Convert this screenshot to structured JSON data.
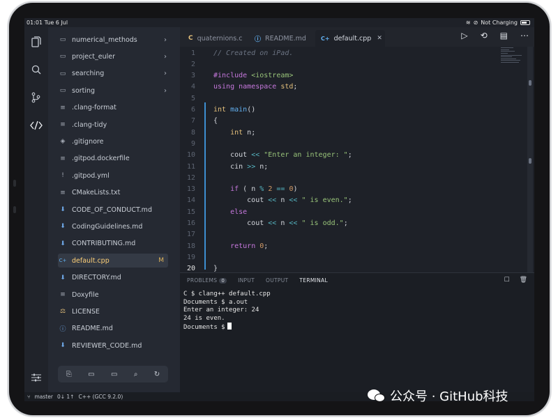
{
  "status": {
    "time_date": "01:01  Tue 6 Jul",
    "battery_text": "Not Charging"
  },
  "explorer": {
    "items": [
      {
        "icon": "folder",
        "label": "numerical_methods",
        "arrow": true
      },
      {
        "icon": "folder",
        "label": "project_euler",
        "arrow": true
      },
      {
        "icon": "folder",
        "label": "searching",
        "arrow": true
      },
      {
        "icon": "folder",
        "label": "sorting",
        "arrow": true
      },
      {
        "icon": "lines",
        "label": ".clang-format"
      },
      {
        "icon": "lines",
        "label": ".clang-tidy"
      },
      {
        "icon": "git",
        "label": ".gitignore"
      },
      {
        "icon": "lines",
        "label": ".gitpod.dockerfile"
      },
      {
        "icon": "bang",
        "label": ".gitpod.yml"
      },
      {
        "icon": "lines",
        "label": "CMakeLists.txt"
      },
      {
        "icon": "md",
        "label": "CODE_OF_CONDUCT.md"
      },
      {
        "icon": "md",
        "label": "CodingGuidelines.md"
      },
      {
        "icon": "md",
        "label": "CONTRIBUTING.md"
      },
      {
        "icon": "cpp",
        "label": "default.cpp",
        "selected": true,
        "mod": "M"
      },
      {
        "icon": "md",
        "label": "DIRECTORY.md"
      },
      {
        "icon": "lines",
        "label": "Doxyfile"
      },
      {
        "icon": "license",
        "label": "LICENSE"
      },
      {
        "icon": "info",
        "label": "README.md"
      },
      {
        "icon": "md",
        "label": "REVIEWER_CODE.md"
      }
    ]
  },
  "tabs": [
    {
      "icon": "C",
      "label": "quaternions.c",
      "active": false
    },
    {
      "icon": "ⓘ",
      "label": "README.md",
      "active": false
    },
    {
      "icon": "C+",
      "label": "default.cpp",
      "active": true,
      "close": "✕"
    }
  ],
  "editor": {
    "lines": [
      {
        "n": "1",
        "tokens": [
          [
            "c-comment",
            "// Created on iPad."
          ]
        ]
      },
      {
        "n": "2",
        "tokens": []
      },
      {
        "n": "3",
        "tokens": [
          [
            "c-kw",
            "#include"
          ],
          [
            "c-plain",
            " "
          ],
          [
            "c-str",
            "<iostream>"
          ]
        ]
      },
      {
        "n": "4",
        "tokens": [
          [
            "c-kw",
            "using"
          ],
          [
            "c-plain",
            " "
          ],
          [
            "c-kw",
            "namespace"
          ],
          [
            "c-plain",
            " "
          ],
          [
            "c-type",
            "std"
          ],
          [
            "c-plain",
            ";"
          ]
        ]
      },
      {
        "n": "5",
        "tokens": []
      },
      {
        "n": "6",
        "tokens": [
          [
            "c-type",
            "int"
          ],
          [
            "c-plain",
            " "
          ],
          [
            "c-fn",
            "main"
          ],
          [
            "c-plain",
            "()"
          ]
        ]
      },
      {
        "n": "7",
        "tokens": [
          [
            "c-plain",
            "{"
          ]
        ]
      },
      {
        "n": "8",
        "tokens": [
          [
            "c-plain",
            "    "
          ],
          [
            "c-type",
            "int"
          ],
          [
            "c-plain",
            " n;"
          ]
        ]
      },
      {
        "n": "9",
        "tokens": []
      },
      {
        "n": "10",
        "tokens": [
          [
            "c-plain",
            "    cout "
          ],
          [
            "c-op",
            "<<"
          ],
          [
            "c-plain",
            " "
          ],
          [
            "c-str",
            "\"Enter an integer: \""
          ],
          [
            "c-plain",
            ";"
          ]
        ]
      },
      {
        "n": "11",
        "tokens": [
          [
            "c-plain",
            "    cin "
          ],
          [
            "c-op",
            ">>"
          ],
          [
            "c-plain",
            " n;"
          ]
        ]
      },
      {
        "n": "12",
        "tokens": []
      },
      {
        "n": "13",
        "tokens": [
          [
            "c-plain",
            "    "
          ],
          [
            "c-kw",
            "if"
          ],
          [
            "c-plain",
            " ( n "
          ],
          [
            "c-op",
            "%"
          ],
          [
            "c-plain",
            " "
          ],
          [
            "c-num",
            "2"
          ],
          [
            "c-plain",
            " "
          ],
          [
            "c-op",
            "=="
          ],
          [
            "c-plain",
            " "
          ],
          [
            "c-num",
            "0"
          ],
          [
            "c-plain",
            ")"
          ]
        ]
      },
      {
        "n": "14",
        "tokens": [
          [
            "c-plain",
            "        cout "
          ],
          [
            "c-op",
            "<<"
          ],
          [
            "c-plain",
            " n "
          ],
          [
            "c-op",
            "<<"
          ],
          [
            "c-plain",
            " "
          ],
          [
            "c-str",
            "\" is even.\""
          ],
          [
            "c-plain",
            ";"
          ]
        ]
      },
      {
        "n": "15",
        "tokens": [
          [
            "c-plain",
            "    "
          ],
          [
            "c-kw",
            "else"
          ]
        ]
      },
      {
        "n": "16",
        "tokens": [
          [
            "c-plain",
            "        cout "
          ],
          [
            "c-op",
            "<<"
          ],
          [
            "c-plain",
            " n "
          ],
          [
            "c-op",
            "<<"
          ],
          [
            "c-plain",
            " "
          ],
          [
            "c-str",
            "\" is odd.\""
          ],
          [
            "c-plain",
            ";"
          ]
        ]
      },
      {
        "n": "17",
        "tokens": []
      },
      {
        "n": "18",
        "tokens": [
          [
            "c-plain",
            "    "
          ],
          [
            "c-kw",
            "return"
          ],
          [
            "c-plain",
            " "
          ],
          [
            "c-num",
            "0"
          ],
          [
            "c-plain",
            ";"
          ]
        ]
      },
      {
        "n": "19",
        "tokens": []
      },
      {
        "n": "20",
        "tokens": [
          [
            "c-plain",
            "}"
          ]
        ],
        "current": true
      }
    ]
  },
  "panel": {
    "tabs": [
      "PROBLEMS",
      "INPUT",
      "OUTPUT",
      "TERMINAL"
    ],
    "problems_count": "0",
    "active_tab": "TERMINAL",
    "terminal": "C $ clang++ default.cpp\nDocuments $ a.out\nEnter an integer: 24\n24 is even.\nDocuments $"
  },
  "statusbar": {
    "branch": "master",
    "sync": "0↓ 1↑",
    "language": "C++ (GCC 9.2.0)"
  },
  "watermark": {
    "text": "公众号 · GitHub科技"
  }
}
